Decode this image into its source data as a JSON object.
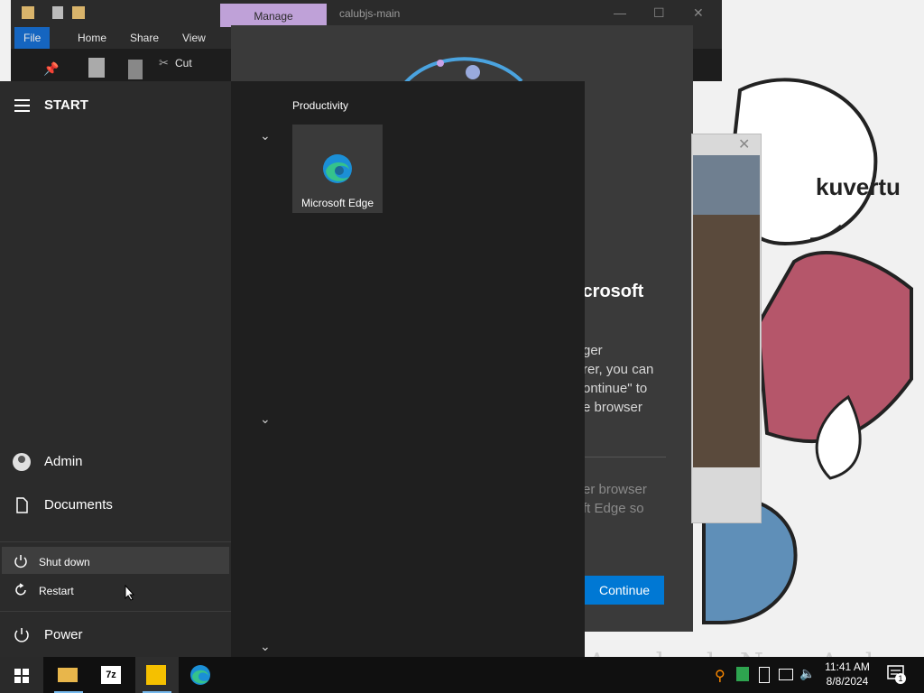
{
  "explorer": {
    "manage_tab": "Manage",
    "title": "calubjs-main",
    "tabs": [
      "File",
      "Home",
      "Share",
      "View"
    ],
    "cut_label": "Cut",
    "help": "?"
  },
  "wallpaper": {
    "character_label": "kuvertu",
    "watermark": "CherrydoBoloAconha da Neva Ands"
  },
  "edge_dialog": {
    "title": "icrosoft",
    "body": "ger\nrer, you can\nontinue\" to\ne browser",
    "sub": "er browser\nft Edge so",
    "continue_label": "Continue"
  },
  "start_menu": {
    "title": "START",
    "user": "Admin",
    "documents": "Documents",
    "power_flyout": {
      "shutdown": "Shut down",
      "restart": "Restart"
    },
    "power": "Power",
    "group_title": "Productivity",
    "tiles": [
      {
        "label": "Microsoft Edge",
        "icon": "edge-icon"
      }
    ]
  },
  "taskbar": {
    "apps": [
      "file-explorer-icon",
      "7zip-icon",
      "app-icon",
      "edge-icon"
    ],
    "time": "11:41 AM",
    "date": "8/8/2024",
    "notification_count": "1"
  },
  "colors": {
    "accent": "#0078d4",
    "start_left": "#2b2b2b",
    "start_right": "#1f1f1f",
    "taskbar": "#101010"
  }
}
